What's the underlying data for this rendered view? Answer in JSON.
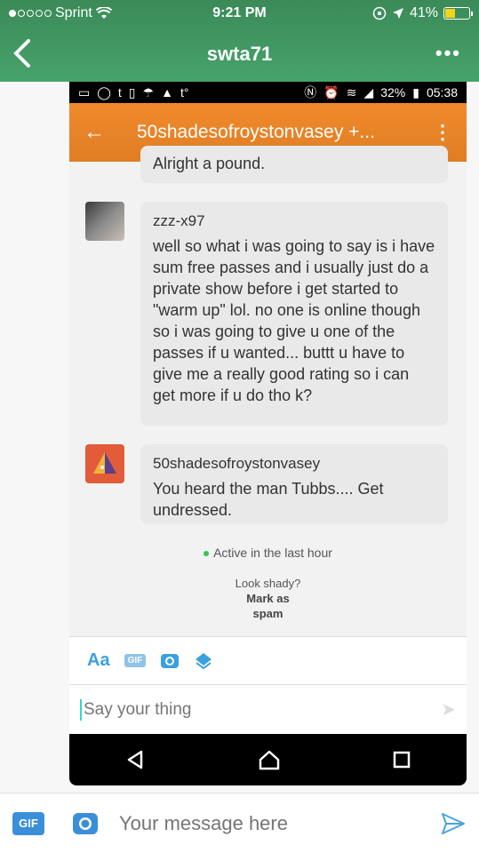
{
  "ios_status": {
    "carrier": "Sprint",
    "time": "9:21 PM",
    "battery": "41%"
  },
  "ios_nav": {
    "title": "swta71",
    "more": "•••"
  },
  "android_status": {
    "icons_left": [
      "messages-icon",
      "whatsapp-icon",
      "tumblr-icon",
      "clipboard-icon",
      "weather-icon",
      "gallery-icon",
      "tumblr-icon"
    ],
    "temp": "63°F",
    "battery": "32%",
    "time": "05:38"
  },
  "android_appbar": {
    "title": "50shadesofroystonvasey +..."
  },
  "chat": {
    "partial_message": "Alright a pound.",
    "messages": [
      {
        "sender": "zzz-x97",
        "text": "well so what i was going to say is i have sum free passes and i usually just do a private show before i get started to \"warm up\" lol. no one is online though so i was going to give u one of the passes if u wanted... buttt u have to give me a really good rating so i can get more if u do tho k?"
      },
      {
        "sender": "50shadesofroystonvasey",
        "text": "You heard the man Tubbs.... Get undressed."
      }
    ],
    "active_status": "Active in the last hour",
    "look_shady": "Look shady?",
    "mark_as": "Mark as",
    "spam": "spam"
  },
  "android_toolbar": {
    "aa_label": "Aa",
    "gif_label": "GIF"
  },
  "android_input": {
    "placeholder": "Say your thing"
  },
  "ios_bottom": {
    "gif_label": "GIF",
    "placeholder": "Your message here"
  },
  "colors": {
    "ios_green": "#46a36a",
    "android_orange": "#e88330",
    "accent_blue": "#3b8fd9"
  }
}
